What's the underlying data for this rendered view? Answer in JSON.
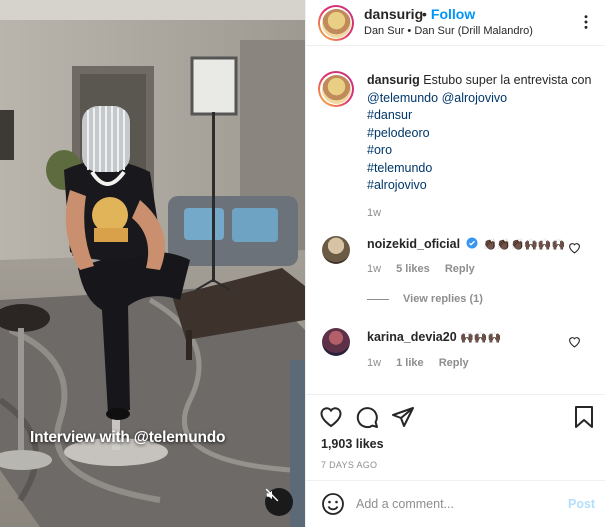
{
  "video": {
    "caption": "Interview with @telemundo"
  },
  "header": {
    "username": "dansurig",
    "separator": "•",
    "follow_label": "Follow",
    "subtitle": "Dan Sur • Dan Sur (Drill Malandro)"
  },
  "post_caption": {
    "username": "dansurig",
    "text": "Estubo super la entrevista con",
    "mentions": [
      "@telemundo",
      "@alrojovivo"
    ],
    "hashtags": [
      "#dansur",
      "#pelodeoro",
      "#oro",
      "#telemundo",
      "#alrojovivo"
    ],
    "age": "1w"
  },
  "comments": [
    {
      "username": "noizekid_oficial",
      "verified": true,
      "text": "👏🏿👏🏿👏🏿🙌🏿🙌🏿🙌🏿",
      "age": "1w",
      "likes": "5 likes",
      "reply_label": "Reply",
      "view_replies": "View replies (1)"
    },
    {
      "username": "karina_devia20",
      "verified": false,
      "text": "🙌🏿🙌🏿🙌🏿",
      "age": "1w",
      "likes": "1 like",
      "reply_label": "Reply"
    }
  ],
  "actions": {
    "likes": "1,903 likes",
    "date": "7 DAYS AGO"
  },
  "add_comment": {
    "placeholder": "Add a comment...",
    "post_label": "Post"
  },
  "icons": {
    "header": [
      "more-options-icon"
    ],
    "actions": [
      "heart-icon",
      "comment-icon",
      "share-icon",
      "bookmark-icon"
    ],
    "video": [
      "muted-speaker-icon"
    ],
    "input": [
      "emoji-icon"
    ],
    "badge": "verified-badge-icon"
  },
  "colors": {
    "accent": "#0095f6",
    "post_disabled": "#b2dffc",
    "link": "#00376b",
    "muted_text": "#8e8e8e"
  }
}
